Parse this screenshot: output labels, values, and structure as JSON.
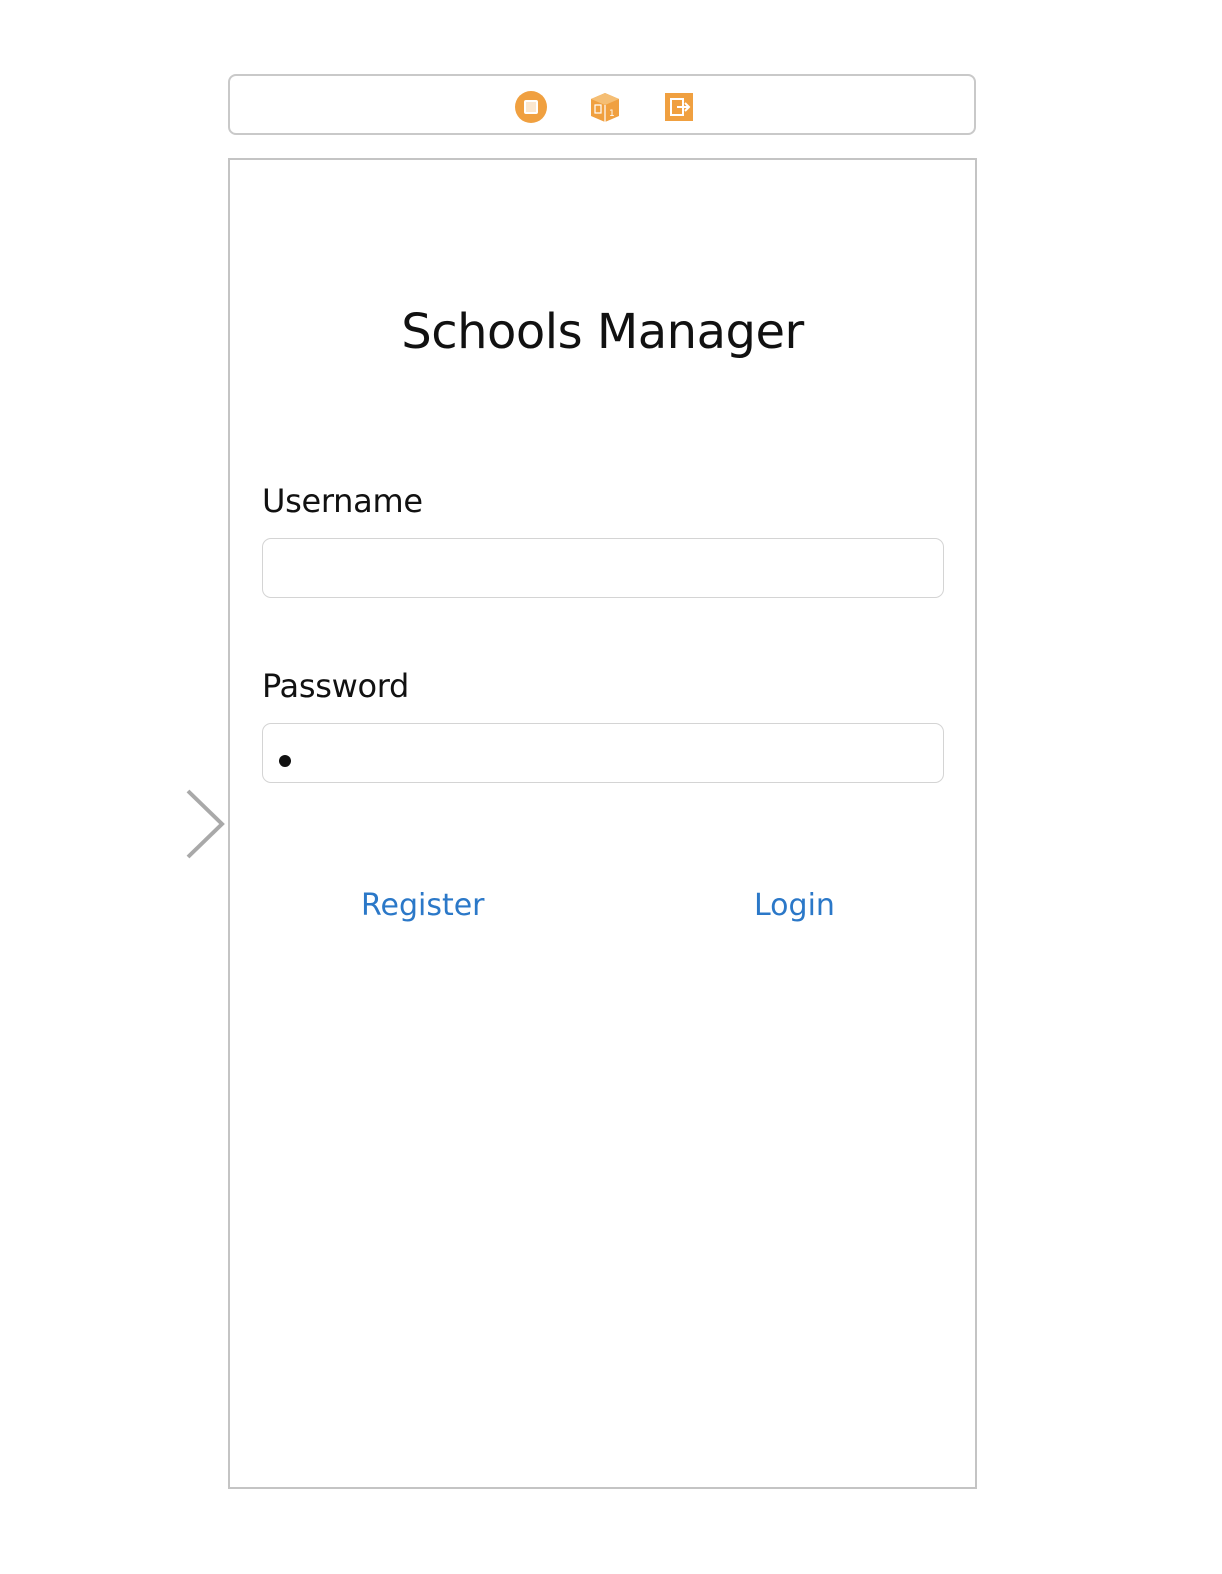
{
  "scene_dock": {
    "icons": [
      "view-controller-icon",
      "first-responder-icon",
      "exit-icon"
    ],
    "accent_color": "#f0a040"
  },
  "screen": {
    "title": "Schools Manager",
    "username": {
      "label": "Username",
      "value": ""
    },
    "password": {
      "label": "Password",
      "masked_char_count": 1
    },
    "register_label": "Register",
    "login_label": "Login",
    "link_color": "#2b78c8"
  },
  "entry_point": {
    "icon": "initial-view-controller-arrow-icon"
  }
}
